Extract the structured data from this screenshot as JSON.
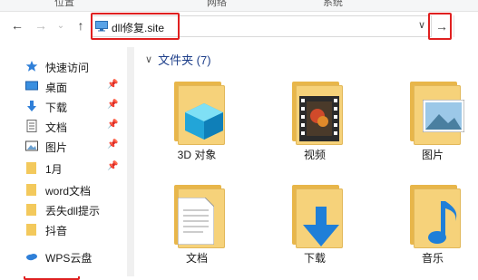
{
  "ribbon": {
    "groups": [
      "位置",
      "网络",
      "系统"
    ]
  },
  "nav": {
    "back": "←",
    "forward": "→",
    "dropdown": "⌄",
    "up": "↑"
  },
  "address": {
    "path": "dll修复.site",
    "dropdown": "∨",
    "go": "→"
  },
  "sidebar": {
    "items": [
      {
        "label": "快速访问",
        "icon": "star-icon"
      },
      {
        "label": "桌面",
        "icon": "desktop-icon",
        "pinned": true
      },
      {
        "label": "下载",
        "icon": "download-icon",
        "pinned": true
      },
      {
        "label": "文档",
        "icon": "document-icon",
        "pinned": true
      },
      {
        "label": "图片",
        "icon": "picture-icon",
        "pinned": true
      },
      {
        "label": "1月",
        "icon": "folder-icon",
        "pinned": true
      },
      {
        "label": "word文档",
        "icon": "folder-icon"
      },
      {
        "label": "丢失dll提示",
        "icon": "folder-icon"
      },
      {
        "label": "抖音",
        "icon": "folder-icon"
      },
      {
        "label": "WPS云盘",
        "icon": "cloud-icon"
      }
    ],
    "pin_glyph": "📌"
  },
  "main": {
    "section_title": "文件夹 (7)",
    "chevron": "∨",
    "tiles": [
      {
        "label": "3D 对象",
        "icon": "3d-objects-folder-icon"
      },
      {
        "label": "视频",
        "icon": "videos-folder-icon"
      },
      {
        "label": "图片",
        "icon": "pictures-folder-icon"
      },
      {
        "label": "文档",
        "icon": "documents-folder-icon"
      },
      {
        "label": "下载",
        "icon": "downloads-folder-icon"
      },
      {
        "label": "音乐",
        "icon": "music-folder-icon"
      }
    ]
  },
  "colors": {
    "highlight": "#e02020",
    "folder": "#f6d27a",
    "header_blue": "#1e3f8a"
  }
}
